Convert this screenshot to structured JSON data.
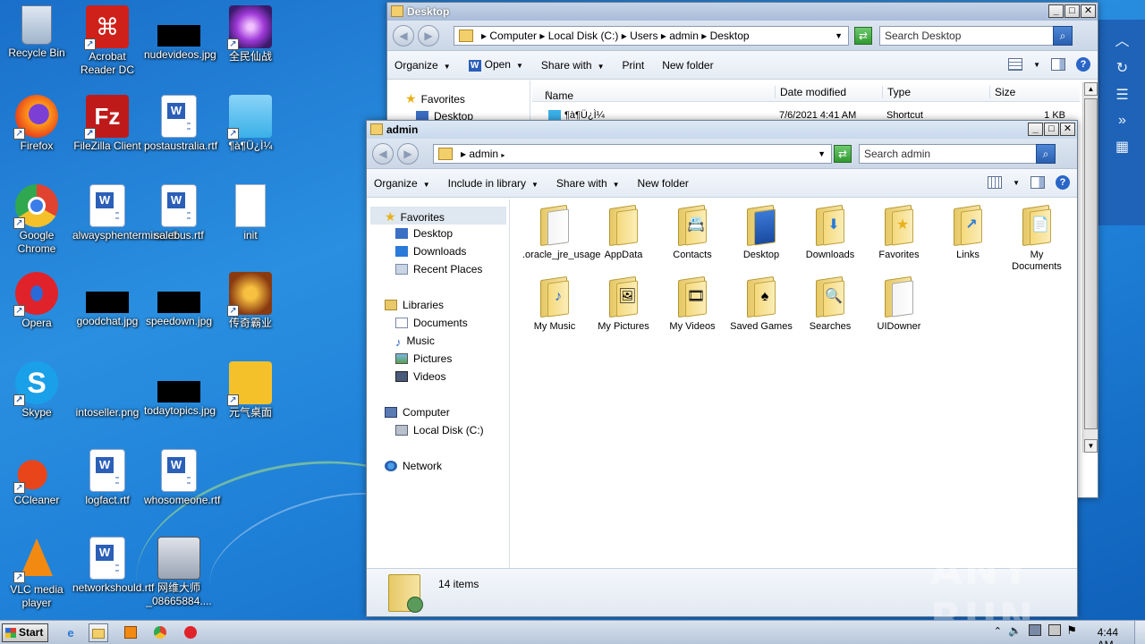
{
  "desktop": {
    "icons": [
      {
        "label": "Recycle Bin"
      },
      {
        "label": "Acrobat Reader DC"
      },
      {
        "label": "nudevideos.jpg"
      },
      {
        "label": "全民仙战"
      },
      {
        "label": "Firefox"
      },
      {
        "label": "FileZilla Client"
      },
      {
        "label": "postaustralia.rtf"
      },
      {
        "label": "¶à¶Ü¿Ì¼"
      },
      {
        "label": "Google Chrome"
      },
      {
        "label": "alwaysphentermine.rtf"
      },
      {
        "label": "salebus.rtf"
      },
      {
        "label": "init"
      },
      {
        "label": "Opera"
      },
      {
        "label": "goodchat.jpg"
      },
      {
        "label": "speedown.jpg"
      },
      {
        "label": "传奇霸业"
      },
      {
        "label": "Skype"
      },
      {
        "label": "intoseller.png"
      },
      {
        "label": "todaytopics.jpg"
      },
      {
        "label": "元气桌面"
      },
      {
        "label": "CCleaner"
      },
      {
        "label": "logfact.rtf"
      },
      {
        "label": "whosomeone.rtf"
      },
      {
        "label": "VLC media player"
      },
      {
        "label": "networkshould.rtf"
      },
      {
        "label": "网维大师_08665884...."
      }
    ]
  },
  "win_desktop": {
    "title": "Desktop",
    "breadcrumb": [
      "Computer",
      "Local Disk (C:)",
      "Users",
      "admin",
      "Desktop"
    ],
    "search_placeholder": "Search Desktop",
    "toolbar": [
      "Organize",
      "Open",
      "Share with",
      "Print",
      "New folder"
    ],
    "nav": [
      "Favorites",
      "Desktop"
    ],
    "columns": [
      "Name",
      "Date modified",
      "Type",
      "Size"
    ],
    "rows": [
      {
        "name": "¶à¶Ü¿Ì¼",
        "date": "7/6/2021 4:41 AM",
        "type": "Shortcut",
        "size": "1 KB"
      }
    ]
  },
  "win_admin": {
    "title": "admin",
    "breadcrumb": [
      "admin"
    ],
    "search_placeholder": "Search admin",
    "toolbar": [
      "Organize",
      "Include in library",
      "Share with",
      "New folder"
    ],
    "nav": {
      "favorites": {
        "label": "Favorites",
        "items": [
          "Desktop",
          "Downloads",
          "Recent Places"
        ]
      },
      "libraries": {
        "label": "Libraries",
        "items": [
          "Documents",
          "Music",
          "Pictures",
          "Videos"
        ]
      },
      "computer": {
        "label": "Computer",
        "items": [
          "Local Disk (C:)"
        ]
      },
      "network": {
        "label": "Network"
      }
    },
    "folders": [
      {
        "label": ".oracle_jre_usage",
        "badge": ""
      },
      {
        "label": "AppData",
        "badge": ""
      },
      {
        "label": "Contacts",
        "badge": "📇"
      },
      {
        "label": "Desktop",
        "badge": "🖥"
      },
      {
        "label": "Downloads",
        "badge": "⬇"
      },
      {
        "label": "Favorites",
        "badge": "★"
      },
      {
        "label": "Links",
        "badge": "↗"
      },
      {
        "label": "My Documents",
        "badge": "📄"
      },
      {
        "label": "My Music",
        "badge": "♪"
      },
      {
        "label": "My Pictures",
        "badge": "🖼"
      },
      {
        "label": "My Videos",
        "badge": "🎞"
      },
      {
        "label": "Saved Games",
        "badge": "♠"
      },
      {
        "label": "Searches",
        "badge": "🔍"
      },
      {
        "label": "UIDowner",
        "badge": ""
      }
    ],
    "status": "14 items"
  },
  "taskbar": {
    "start": "Start",
    "clock": "4:44 AM"
  },
  "watermark": "ANY RUN"
}
